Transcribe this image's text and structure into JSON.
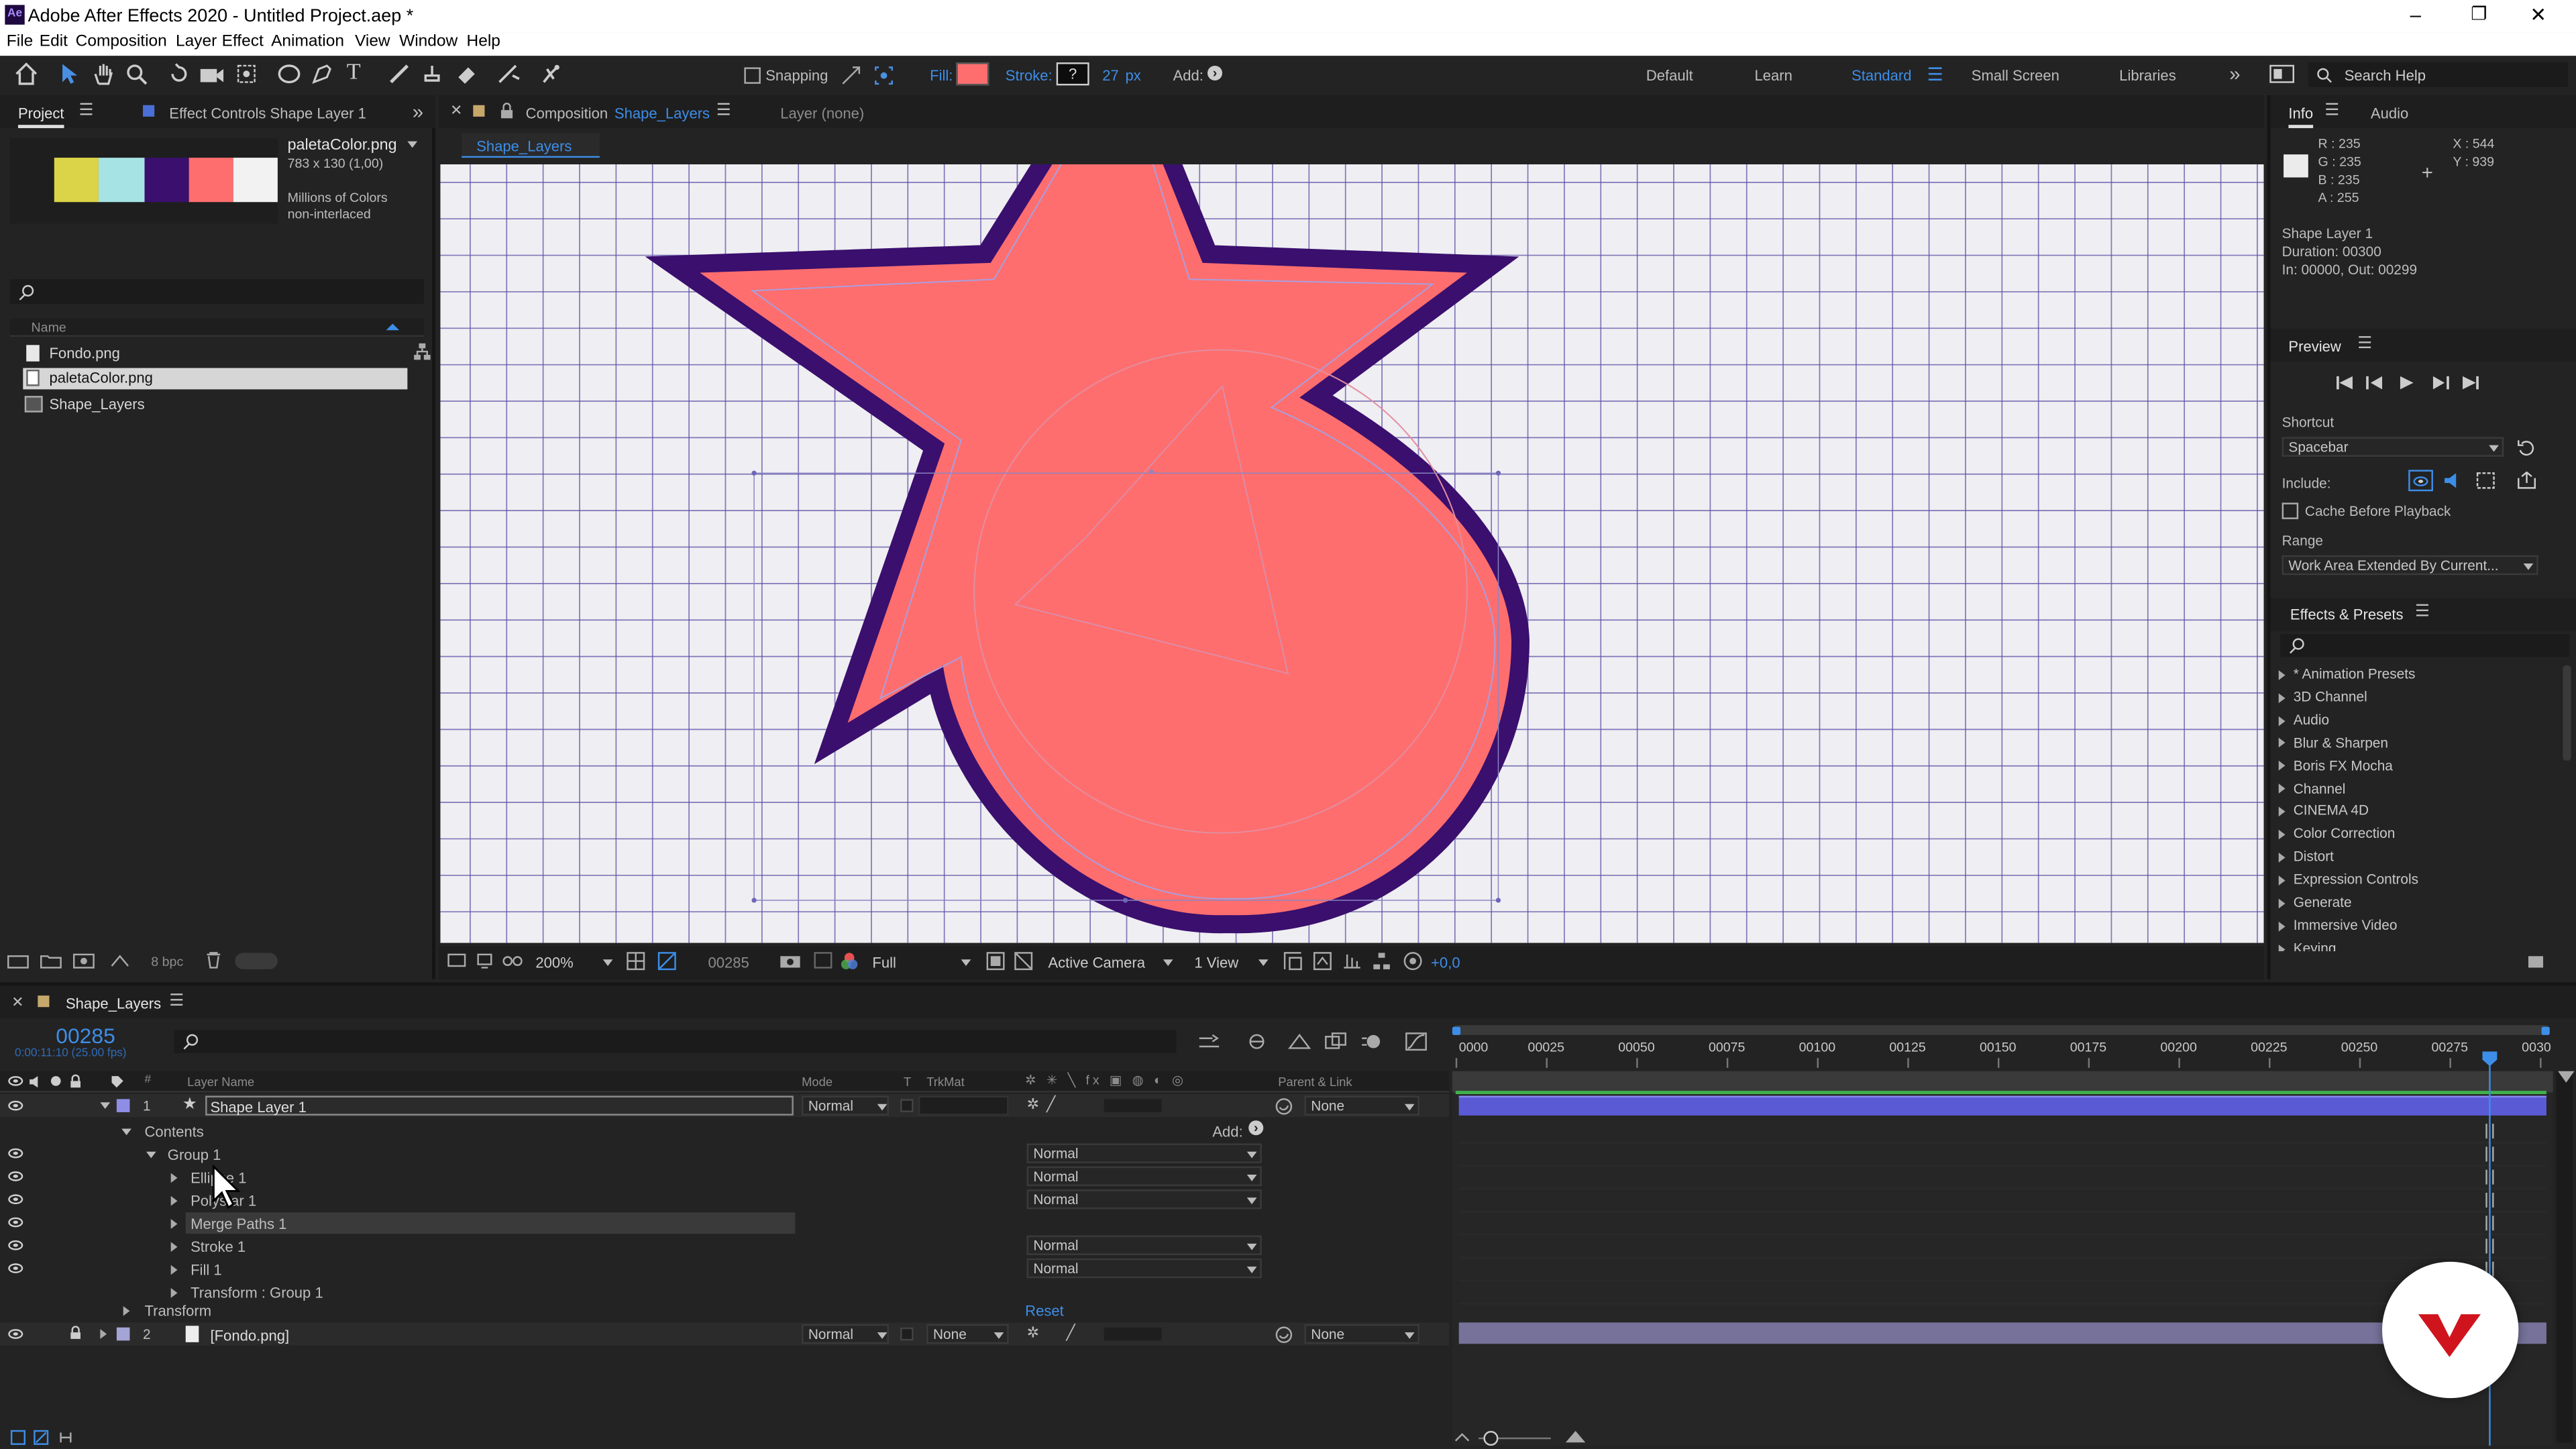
{
  "window": {
    "title": "Adobe After Effects 2020 - Untitled Project.aep *",
    "app_icon": "Ae",
    "minimize": "–",
    "maximize": "❐",
    "close": "✕"
  },
  "menu": [
    "File",
    "Edit",
    "Composition",
    "Layer",
    "Effect",
    "Animation",
    "View",
    "Window",
    "Help"
  ],
  "toolbar": {
    "snapping": "Snapping",
    "fill": "Fill:",
    "stroke": "Stroke:",
    "stroke_value": "?",
    "stroke_px": "27",
    "px": "px",
    "add": "Add:",
    "fill_color": "#ff6e6e",
    "stroke_box_color": "#0d0d0d"
  },
  "workspaces": [
    "Default",
    "Learn",
    "Standard",
    "Small Screen",
    "Libraries"
  ],
  "search_help": "Search Help",
  "project": {
    "tab": "Project",
    "effect_tab": "Effect Controls Shape Layer 1",
    "file_name": "paletaColor.png",
    "dims": "783 x 130 (1,00)",
    "colors": "Millions of Colors",
    "interlace": "non-interlaced",
    "palette": [
      "#1e1e1e",
      "#dbd448",
      "#a6e3e4",
      "#3a0f6e",
      "#ff6e6e",
      "#f2f2f2"
    ],
    "col_name": "Name",
    "items": [
      "Fondo.png",
      "paletaColor.png",
      "Shape_Layers"
    ],
    "bpc": "8 bpc"
  },
  "comp": {
    "tab_prefix": "Composition",
    "tab_name": "Shape_Layers",
    "layer_tab": "Layer (none)",
    "subtab": "Shape_Layers",
    "zoom": "200%",
    "timecode": "00285",
    "resolution": "Full",
    "camera": "Active Camera",
    "views": "1 View",
    "exposure": "+0,0",
    "fill_color": "#ff6e6e",
    "stroke_color": "#3a0f6e",
    "bg": "#efeef2",
    "grid_color": "#5d50a6"
  },
  "info": {
    "tab": "Info",
    "audio_tab": "Audio",
    "r": "R : 235",
    "g": "G : 235",
    "b": "B : 235",
    "a": "A : 255",
    "x": "X : 544",
    "y": "Y : 939",
    "layer": "Shape Layer 1",
    "duration": "Duration: 00300",
    "inout": "In: 00000, Out: 00299"
  },
  "preview": {
    "tab": "Preview",
    "shortcut_label": "Shortcut",
    "shortcut": "Spacebar",
    "include": "Include:",
    "cache": "Cache Before Playback",
    "range_label": "Range",
    "range": "Work Area Extended By Current..."
  },
  "effects": {
    "tab": "Effects & Presets",
    "items": [
      "* Animation Presets",
      "3D Channel",
      "Audio",
      "Blur & Sharpen",
      "Boris FX Mocha",
      "Channel",
      "CINEMA 4D",
      "Color Correction",
      "Distort",
      "Expression Controls",
      "Generate",
      "Immersive Video",
      "Keying"
    ]
  },
  "timeline": {
    "tab": "Shape_Layers",
    "timecode": "00285",
    "fps": "0:00:11:10 (25.00 fps)",
    "cols": {
      "layer_name": "Layer Name",
      "mode": "Mode",
      "t": "T",
      "trkmat": "TrkMat",
      "parent": "Parent & Link"
    },
    "layer1": {
      "num": "1",
      "name": "Shape Layer 1",
      "mode": "Normal",
      "parent": "None"
    },
    "contents": "Contents",
    "add": "Add:",
    "group": "Group 1",
    "group_mode": "Normal",
    "sub": [
      {
        "name": "Ellipse 1",
        "mode": "Normal"
      },
      {
        "name": "Polystar 1",
        "mode": "Normal"
      },
      {
        "name": "Merge Paths 1",
        "mode": ""
      },
      {
        "name": "Stroke 1",
        "mode": "Normal"
      },
      {
        "name": "Fill 1",
        "mode": "Normal"
      },
      {
        "name": "Transform : Group 1",
        "mode": ""
      }
    ],
    "transform": "Transform",
    "reset": "Reset",
    "layer2": {
      "num": "2",
      "name": "[Fondo.png]",
      "mode": "Normal",
      "trkmat": "None",
      "parent": "None"
    },
    "ruler": [
      "0000",
      "00025",
      "00050",
      "00075",
      "00100",
      "00125",
      "00150",
      "00175",
      "00200",
      "00225",
      "00250",
      "00275",
      "0030"
    ]
  }
}
